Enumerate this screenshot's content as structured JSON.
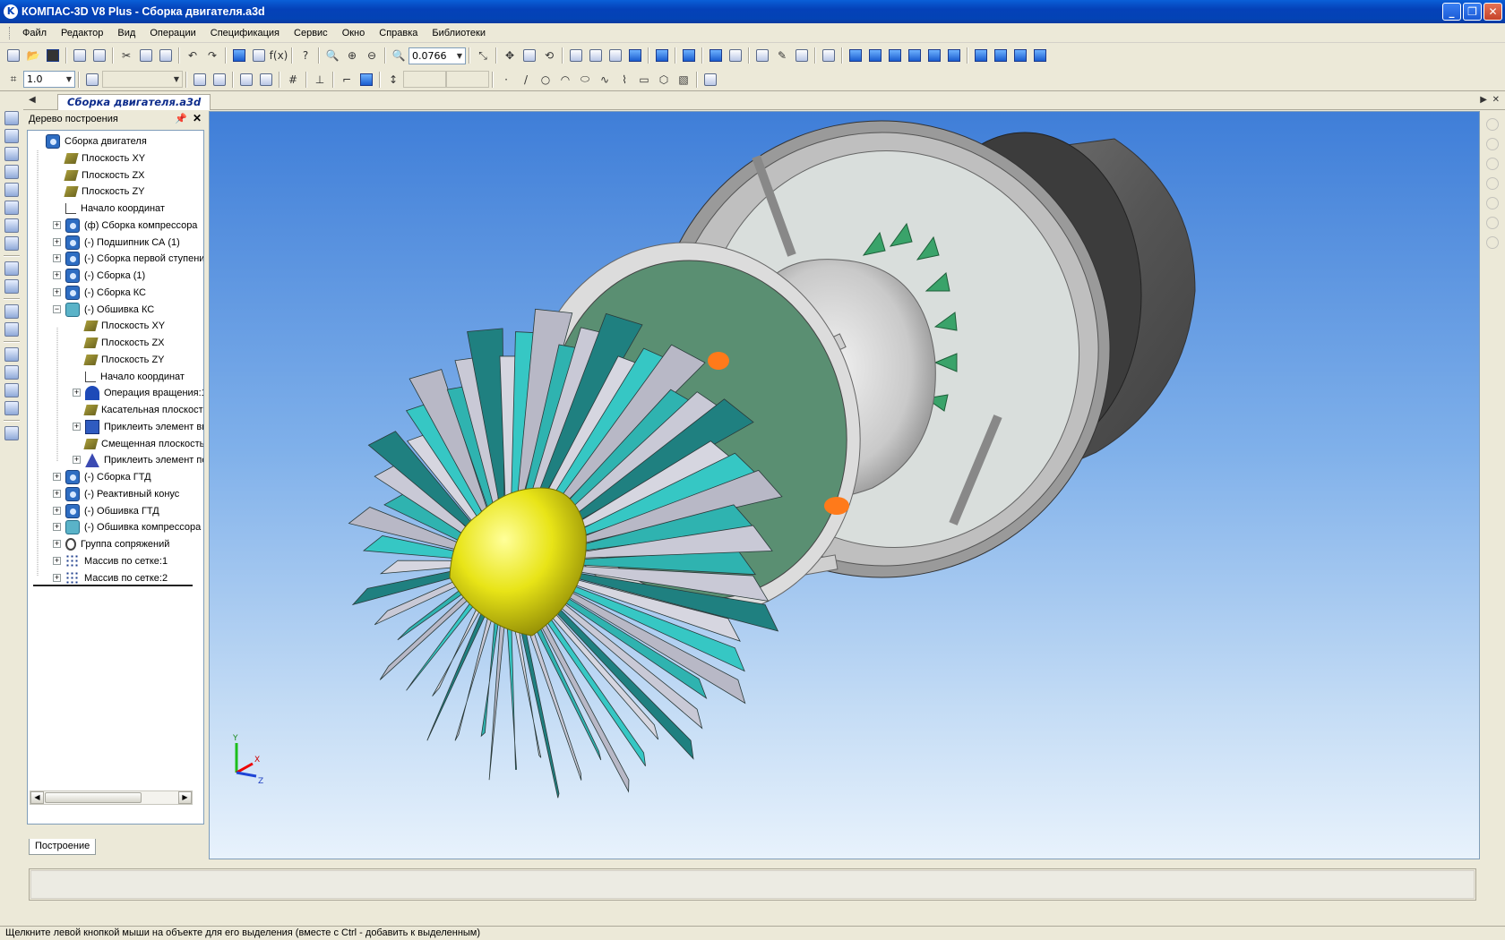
{
  "window": {
    "title": "КОМПАС-3D V8 Plus - Сборка двигателя.a3d",
    "app_icon": "kompas-logo-icon",
    "buttons": [
      "minimize",
      "maximize",
      "close"
    ]
  },
  "menu": [
    "Файл",
    "Редактор",
    "Вид",
    "Операции",
    "Спецификация",
    "Сервис",
    "Окно",
    "Справка",
    "Библиотеки"
  ],
  "toolbar1": {
    "zoom_value": "0.0766"
  },
  "toolbar2": {
    "step_value": "1.0"
  },
  "document_tab": "Сборка двигателя.a3d",
  "tree": {
    "header": "Дерево построения",
    "tab": "Построение",
    "nodes": [
      {
        "label": "Сборка двигателя",
        "icon": "assembly-icon",
        "level": 0,
        "expander": ""
      },
      {
        "label": "Плоскость XY",
        "icon": "plane-icon",
        "level": 1,
        "expander": ""
      },
      {
        "label": "Плоскость ZX",
        "icon": "plane-icon",
        "level": 1,
        "expander": ""
      },
      {
        "label": "Плоскость ZY",
        "icon": "plane-icon",
        "level": 1,
        "expander": ""
      },
      {
        "label": "Начало координат",
        "icon": "origin-icon",
        "level": 1,
        "expander": ""
      },
      {
        "label": "(ф) Сборка компрессора",
        "icon": "assembly-icon",
        "level": 1,
        "expander": "+"
      },
      {
        "label": "(-) Подшипник СА (1)",
        "icon": "assembly-icon",
        "level": 1,
        "expander": "+"
      },
      {
        "label": "(-) Сборка первой ступени С",
        "icon": "assembly-icon",
        "level": 1,
        "expander": "+"
      },
      {
        "label": "(-) Сборка (1)",
        "icon": "assembly-icon",
        "level": 1,
        "expander": "+"
      },
      {
        "label": "(-) Сборка КС",
        "icon": "assembly-icon",
        "level": 1,
        "expander": "+"
      },
      {
        "label": "(-) Обшивка КС",
        "icon": "part-icon",
        "level": 1,
        "expander": "−"
      },
      {
        "label": "Плоскость XY",
        "icon": "plane-icon",
        "level": 2,
        "expander": ""
      },
      {
        "label": "Плоскость ZX",
        "icon": "plane-icon",
        "level": 2,
        "expander": ""
      },
      {
        "label": "Плоскость ZY",
        "icon": "plane-icon",
        "level": 2,
        "expander": ""
      },
      {
        "label": "Начало координат",
        "icon": "origin-icon",
        "level": 2,
        "expander": ""
      },
      {
        "label": "Операция вращения:1",
        "icon": "revolve-icon",
        "level": 2,
        "expander": "+"
      },
      {
        "label": "Касательная плоскость",
        "icon": "plane-icon",
        "level": 2,
        "expander": ""
      },
      {
        "label": "Приклеить элемент вы",
        "icon": "extrude-icon",
        "level": 2,
        "expander": "+"
      },
      {
        "label": "Смещенная плоскость:",
        "icon": "plane-icon",
        "level": 2,
        "expander": ""
      },
      {
        "label": "Приклеить элемент по",
        "icon": "loft-icon",
        "level": 2,
        "expander": "+"
      },
      {
        "label": "(-) Сборка ГТД",
        "icon": "assembly-icon",
        "level": 1,
        "expander": "+"
      },
      {
        "label": "(-) Реактивный конус",
        "icon": "assembly-icon",
        "level": 1,
        "expander": "+"
      },
      {
        "label": "(-) Обшивка ГТД",
        "icon": "assembly-icon",
        "level": 1,
        "expander": "+"
      },
      {
        "label": "(-) Обшивка компрессора",
        "icon": "part-icon",
        "level": 1,
        "expander": "+"
      },
      {
        "label": "Группа сопряжений",
        "icon": "mates-icon",
        "level": 1,
        "expander": "+"
      },
      {
        "label": "Массив по сетке:1",
        "icon": "array-icon",
        "level": 1,
        "expander": "+"
      },
      {
        "label": "Массив по сетке:2",
        "icon": "array-icon",
        "level": 1,
        "expander": "+"
      }
    ]
  },
  "viewport": {
    "axis_labels": {
      "x": "X",
      "y": "Y",
      "z": "Z"
    }
  },
  "status_bar": "Щелкните левой кнопкой мыши на объекте для его выделения (вместе с Ctrl - добавить к выделенным)"
}
